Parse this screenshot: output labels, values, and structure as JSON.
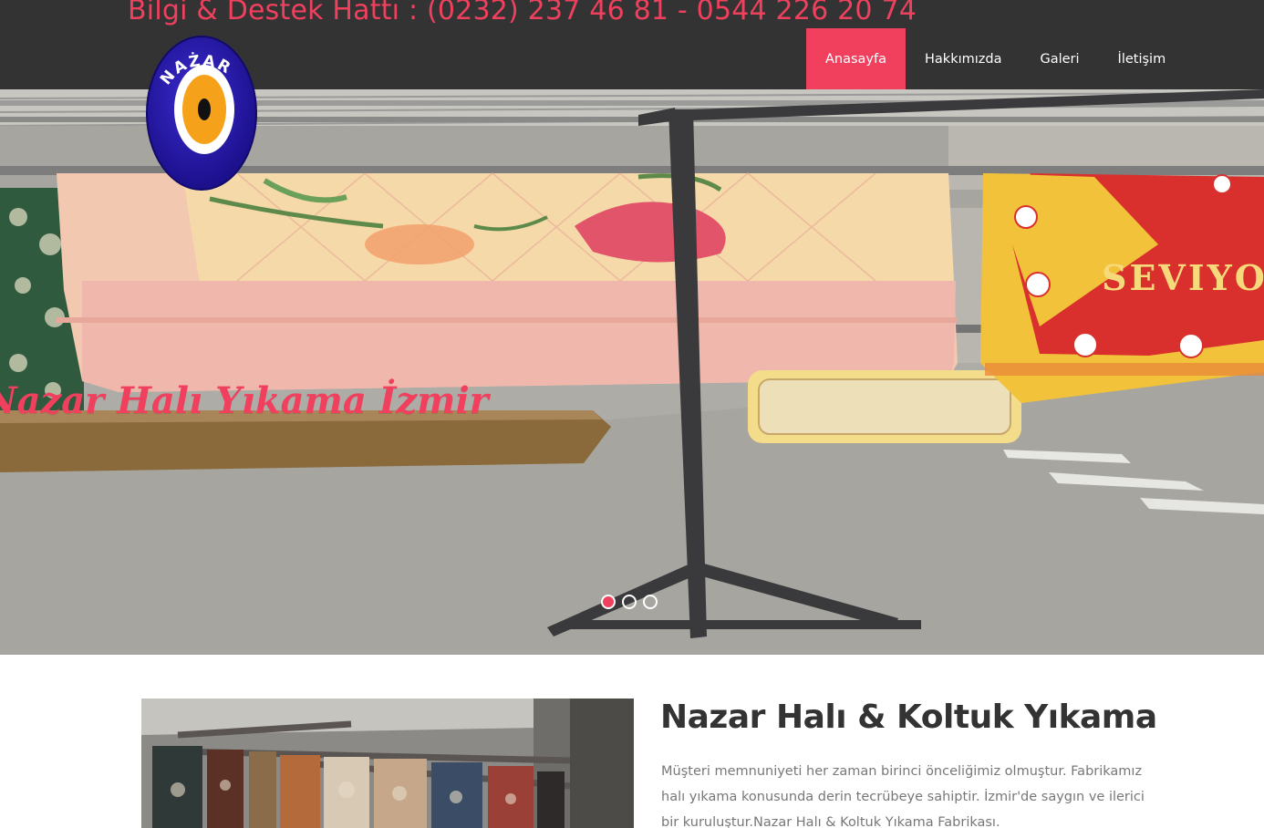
{
  "header": {
    "hotline": "Bilgi & Destek Hattı : (0232) 237 46 81 - 0544 226 20 74",
    "logo_text": "NAŻAR"
  },
  "nav": {
    "items": [
      {
        "label": "Anasayfa",
        "active": true
      },
      {
        "label": "Hakkımızda",
        "active": false
      },
      {
        "label": "Galeri",
        "active": false
      },
      {
        "label": "İletişim",
        "active": false
      }
    ]
  },
  "hero": {
    "caption": "Nazar Halı Yıkama İzmir",
    "blanket_text": "SEVIYO",
    "slides": 3,
    "active_slide": 1
  },
  "content": {
    "title": "Nazar Halı & Koltuk Yıkama",
    "text": "Müşteri memnuniyeti her zaman birinci önceliğimiz olmuştur. Fabrikamız halı yıkama konusunda derin tecrübeye sahiptir. İzmir'de saygın ve ilerici bir kuruluştur.Nazar Halı & Koltuk Yıkama Fabrikası."
  },
  "colors": {
    "accent": "#f0405e",
    "topbar": "#333333",
    "text": "#333333",
    "muted": "#777777",
    "logo_blue": "#2a1aa8",
    "logo_orange": "#f5a21a"
  }
}
